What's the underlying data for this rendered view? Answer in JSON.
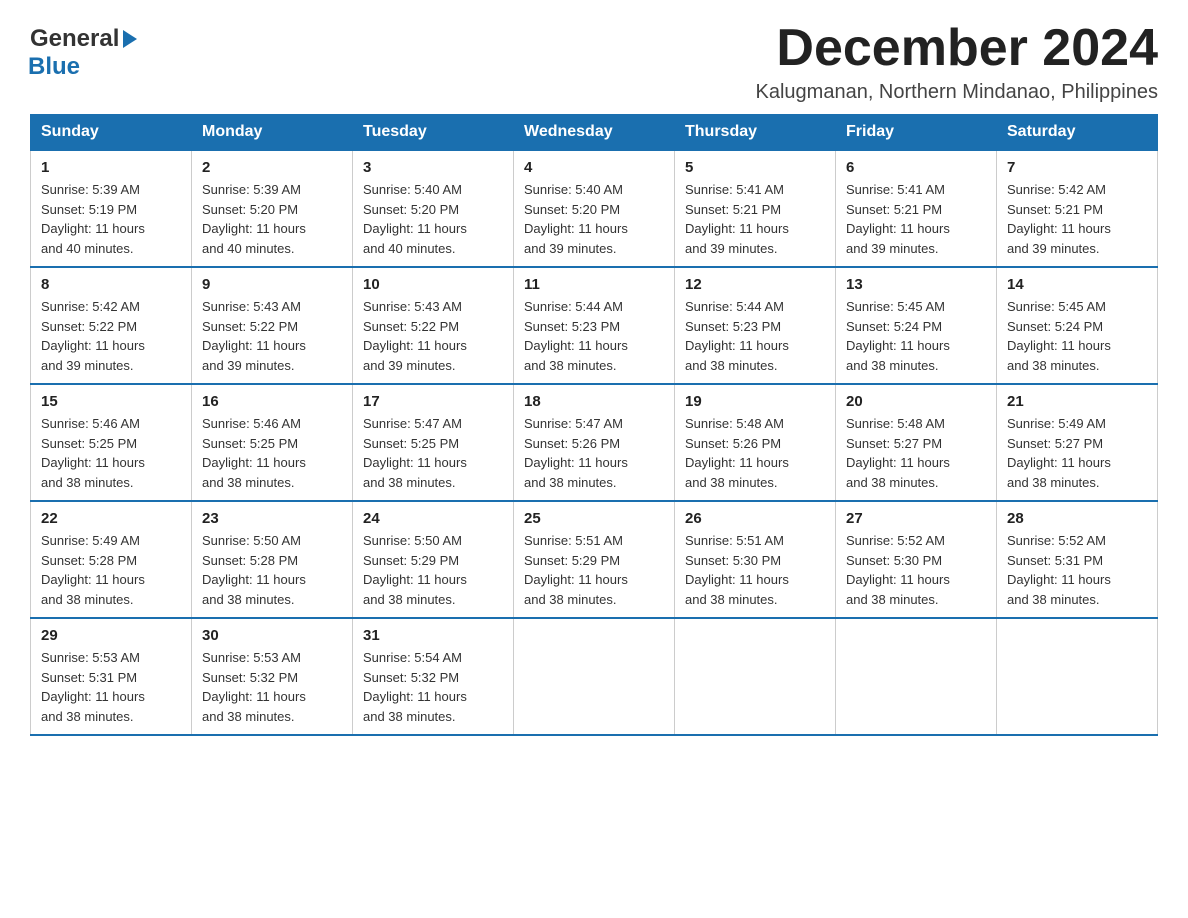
{
  "logo": {
    "general": "General",
    "blue": "Blue"
  },
  "title": "December 2024",
  "subtitle": "Kalugmanan, Northern Mindanao, Philippines",
  "days_of_week": [
    "Sunday",
    "Monday",
    "Tuesday",
    "Wednesday",
    "Thursday",
    "Friday",
    "Saturday"
  ],
  "weeks": [
    [
      {
        "day": "1",
        "sunrise": "5:39 AM",
        "sunset": "5:19 PM",
        "daylight": "11 hours and 40 minutes."
      },
      {
        "day": "2",
        "sunrise": "5:39 AM",
        "sunset": "5:20 PM",
        "daylight": "11 hours and 40 minutes."
      },
      {
        "day": "3",
        "sunrise": "5:40 AM",
        "sunset": "5:20 PM",
        "daylight": "11 hours and 40 minutes."
      },
      {
        "day": "4",
        "sunrise": "5:40 AM",
        "sunset": "5:20 PM",
        "daylight": "11 hours and 39 minutes."
      },
      {
        "day": "5",
        "sunrise": "5:41 AM",
        "sunset": "5:21 PM",
        "daylight": "11 hours and 39 minutes."
      },
      {
        "day": "6",
        "sunrise": "5:41 AM",
        "sunset": "5:21 PM",
        "daylight": "11 hours and 39 minutes."
      },
      {
        "day": "7",
        "sunrise": "5:42 AM",
        "sunset": "5:21 PM",
        "daylight": "11 hours and 39 minutes."
      }
    ],
    [
      {
        "day": "8",
        "sunrise": "5:42 AM",
        "sunset": "5:22 PM",
        "daylight": "11 hours and 39 minutes."
      },
      {
        "day": "9",
        "sunrise": "5:43 AM",
        "sunset": "5:22 PM",
        "daylight": "11 hours and 39 minutes."
      },
      {
        "day": "10",
        "sunrise": "5:43 AM",
        "sunset": "5:22 PM",
        "daylight": "11 hours and 39 minutes."
      },
      {
        "day": "11",
        "sunrise": "5:44 AM",
        "sunset": "5:23 PM",
        "daylight": "11 hours and 38 minutes."
      },
      {
        "day": "12",
        "sunrise": "5:44 AM",
        "sunset": "5:23 PM",
        "daylight": "11 hours and 38 minutes."
      },
      {
        "day": "13",
        "sunrise": "5:45 AM",
        "sunset": "5:24 PM",
        "daylight": "11 hours and 38 minutes."
      },
      {
        "day": "14",
        "sunrise": "5:45 AM",
        "sunset": "5:24 PM",
        "daylight": "11 hours and 38 minutes."
      }
    ],
    [
      {
        "day": "15",
        "sunrise": "5:46 AM",
        "sunset": "5:25 PM",
        "daylight": "11 hours and 38 minutes."
      },
      {
        "day": "16",
        "sunrise": "5:46 AM",
        "sunset": "5:25 PM",
        "daylight": "11 hours and 38 minutes."
      },
      {
        "day": "17",
        "sunrise": "5:47 AM",
        "sunset": "5:25 PM",
        "daylight": "11 hours and 38 minutes."
      },
      {
        "day": "18",
        "sunrise": "5:47 AM",
        "sunset": "5:26 PM",
        "daylight": "11 hours and 38 minutes."
      },
      {
        "day": "19",
        "sunrise": "5:48 AM",
        "sunset": "5:26 PM",
        "daylight": "11 hours and 38 minutes."
      },
      {
        "day": "20",
        "sunrise": "5:48 AM",
        "sunset": "5:27 PM",
        "daylight": "11 hours and 38 minutes."
      },
      {
        "day": "21",
        "sunrise": "5:49 AM",
        "sunset": "5:27 PM",
        "daylight": "11 hours and 38 minutes."
      }
    ],
    [
      {
        "day": "22",
        "sunrise": "5:49 AM",
        "sunset": "5:28 PM",
        "daylight": "11 hours and 38 minutes."
      },
      {
        "day": "23",
        "sunrise": "5:50 AM",
        "sunset": "5:28 PM",
        "daylight": "11 hours and 38 minutes."
      },
      {
        "day": "24",
        "sunrise": "5:50 AM",
        "sunset": "5:29 PM",
        "daylight": "11 hours and 38 minutes."
      },
      {
        "day": "25",
        "sunrise": "5:51 AM",
        "sunset": "5:29 PM",
        "daylight": "11 hours and 38 minutes."
      },
      {
        "day": "26",
        "sunrise": "5:51 AM",
        "sunset": "5:30 PM",
        "daylight": "11 hours and 38 minutes."
      },
      {
        "day": "27",
        "sunrise": "5:52 AM",
        "sunset": "5:30 PM",
        "daylight": "11 hours and 38 minutes."
      },
      {
        "day": "28",
        "sunrise": "5:52 AM",
        "sunset": "5:31 PM",
        "daylight": "11 hours and 38 minutes."
      }
    ],
    [
      {
        "day": "29",
        "sunrise": "5:53 AM",
        "sunset": "5:31 PM",
        "daylight": "11 hours and 38 minutes."
      },
      {
        "day": "30",
        "sunrise": "5:53 AM",
        "sunset": "5:32 PM",
        "daylight": "11 hours and 38 minutes."
      },
      {
        "day": "31",
        "sunrise": "5:54 AM",
        "sunset": "5:32 PM",
        "daylight": "11 hours and 38 minutes."
      },
      null,
      null,
      null,
      null
    ]
  ],
  "labels": {
    "sunrise": "Sunrise:",
    "sunset": "Sunset:",
    "daylight": "Daylight:"
  }
}
